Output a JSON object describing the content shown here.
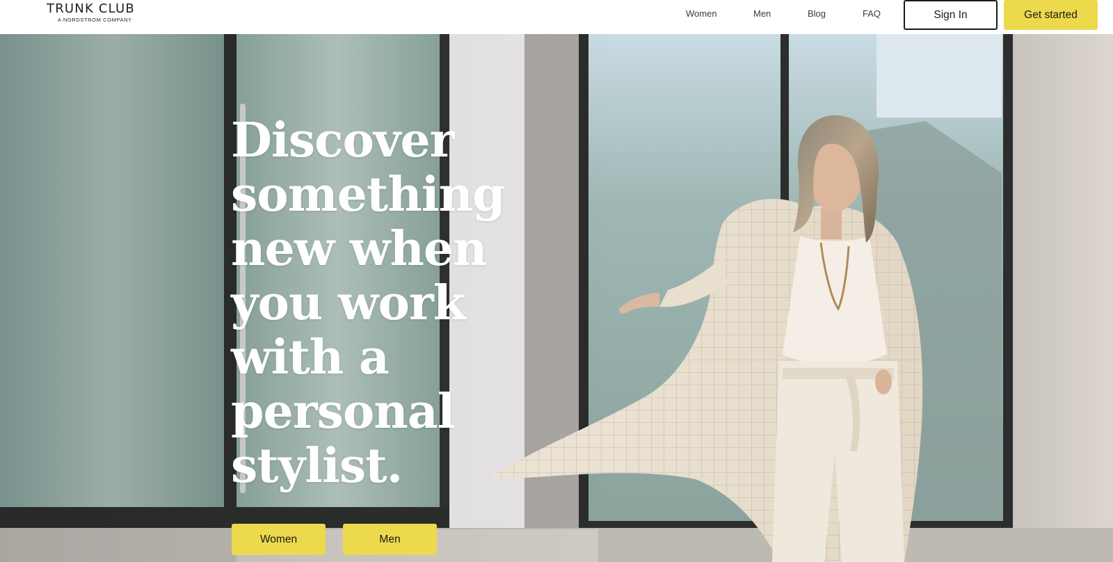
{
  "header": {
    "logo": {
      "name": "TRUNK CLUB",
      "tagline": "A NORDSTROM COMPANY"
    },
    "nav": [
      {
        "label": "Women"
      },
      {
        "label": "Men"
      },
      {
        "label": "Blog"
      },
      {
        "label": "FAQ"
      }
    ],
    "sign_in_label": "Sign In",
    "get_started_label": "Get started"
  },
  "hero": {
    "headline": "Discover something new when you work with a personal stylist.",
    "buttons": [
      {
        "label": "Women"
      },
      {
        "label": "Men"
      }
    ]
  },
  "colors": {
    "accent_yellow": "#ecd94c",
    "text_dark": "#1a1a1a",
    "headline_white": "#ffffff"
  }
}
